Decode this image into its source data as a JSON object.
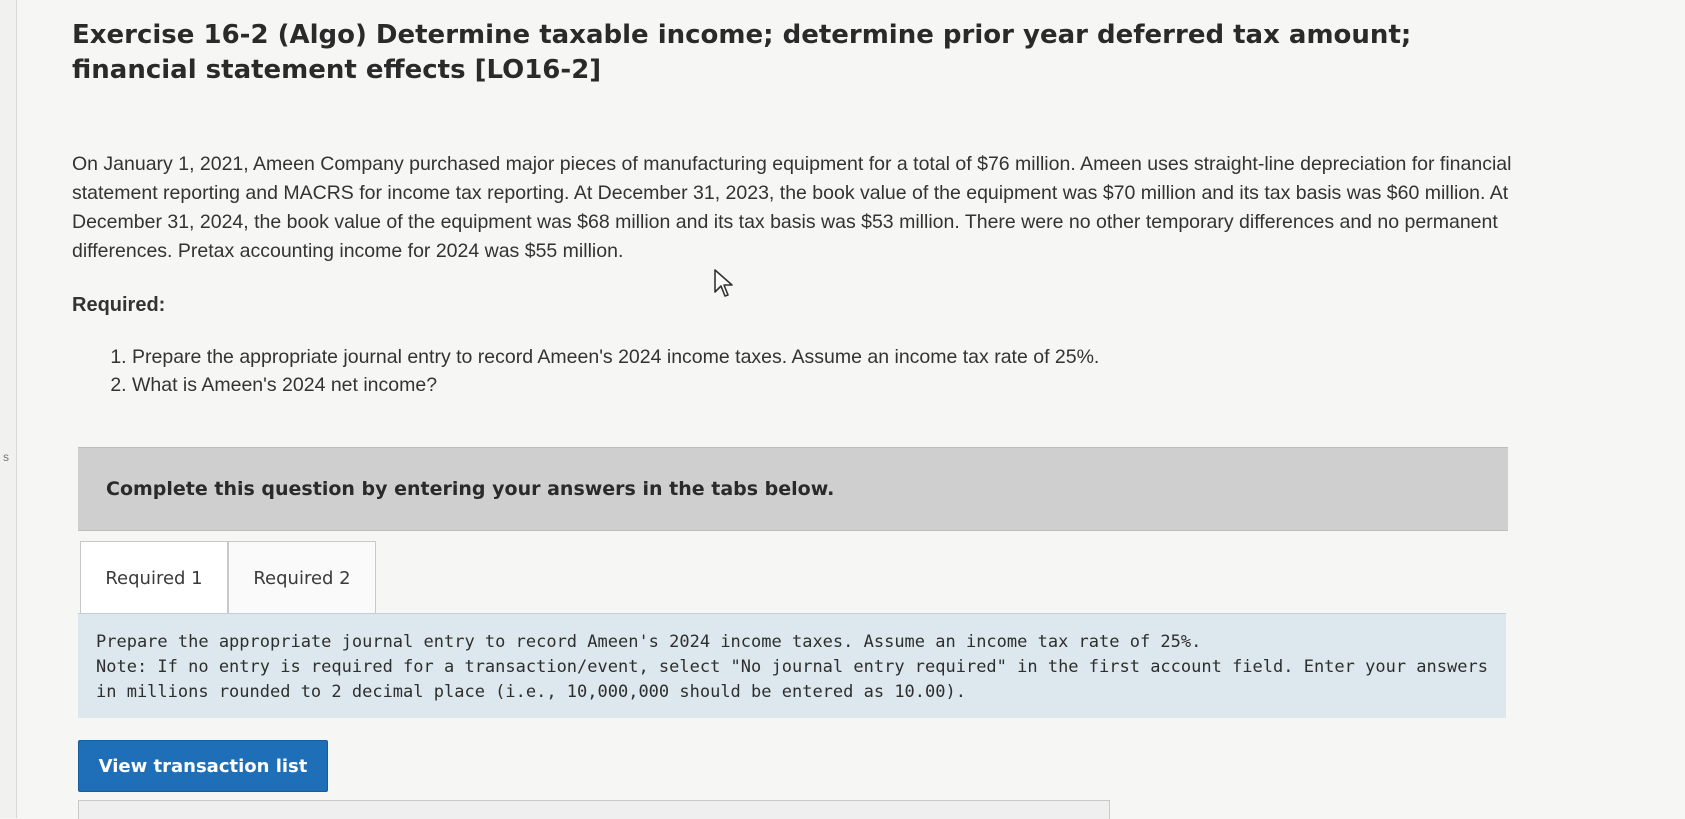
{
  "exercise": {
    "title": "Exercise 16-2 (Algo) Determine taxable income; determine prior year deferred tax amount; financial statement effects [LO16-2]",
    "description": "On January 1, 2021, Ameen Company purchased major pieces of manufacturing equipment for a total of $76 million. Ameen uses straight-line depreciation for financial statement reporting and MACRS for income tax reporting. At December 31, 2023, the book value of the equipment was $70 million and its tax basis was $60 million. At December 31, 2024, the book value of the equipment was $68 million and its tax basis was $53 million. There were no other temporary differences and no permanent differences. Pretax accounting income for 2024 was $55 million.",
    "required_label": "Required:",
    "requirements": [
      "Prepare the appropriate journal entry to record Ameen's 2024 income taxes. Assume an income tax rate of 25%.",
      "What is Ameen's 2024 net income?"
    ]
  },
  "tabs_section": {
    "banner": "Complete this question by entering your answers in the tabs below.",
    "tabs": [
      {
        "label": "Required 1",
        "active": true
      },
      {
        "label": "Required 2",
        "active": false
      }
    ]
  },
  "instructions": {
    "main": "Prepare the appropriate journal entry to record Ameen's 2024 income taxes. Assume an income tax rate of 25%.",
    "note": "Note: If no entry is required for a transaction/event, select \"No journal entry required\" in the first account field. Enter your answers in millions rounded to 2 decimal place (i.e., 10,000,000 should be entered as 10.00)."
  },
  "buttons": {
    "view_transaction_list": "View transaction list"
  },
  "colors": {
    "button": "#1f6fb8",
    "instructions_bg": "#dde8ee",
    "banner_bg": "#cfcfcf"
  }
}
